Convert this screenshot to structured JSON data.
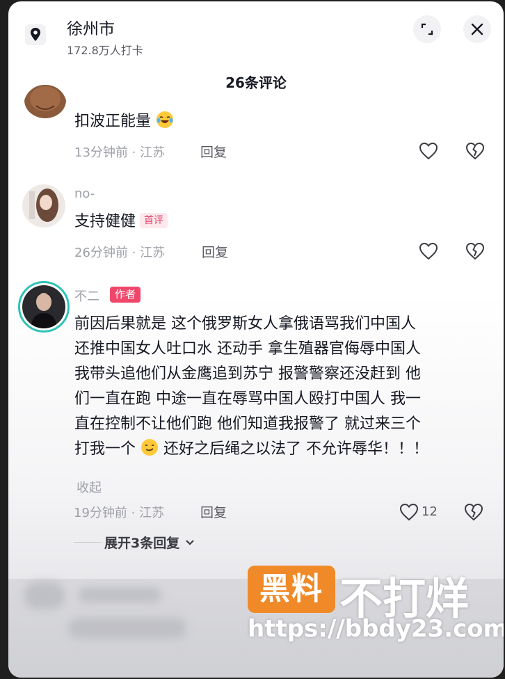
{
  "header": {
    "location_icon": "map-pin-icon",
    "title": "徐州市",
    "subtitle": "172.8万人打卡",
    "expand_icon": "collapse-corner-icon",
    "close_icon": "close-icon"
  },
  "comments_count": "26条评论",
  "comments": [
    {
      "text": "扣波正能量",
      "emoji": "laughing-tears-emoji",
      "time_location": "13分钟前 · 江苏",
      "reply_label": "回复"
    },
    {
      "username": "no-",
      "text": "支持健健",
      "tag": "首评",
      "time_location": "26分钟前 · 江苏",
      "reply_label": "回复"
    },
    {
      "username": "不二",
      "tag": "作者",
      "lines": [
        "前因后果就是 这个俄罗斯女人拿俄语骂我们中国人",
        "还推中国女人吐口水 还动手 拿生殖器官侮辱中国人",
        "我带头追他们从金鹰追到苏宁 报警警察还没赶到 他",
        "们一直在跑 中途一直在辱骂中国人殴打中国人 我一",
        "直在控制不让他们跑 他们知道我报警了 就过来三个",
        "打我一个",
        "还好之后绳之以法了 不允许辱华！！！"
      ],
      "collapse_label": "收起",
      "time_location": "19分钟前 · 江苏",
      "reply_label": "回复",
      "likes": "12",
      "expand_replies": "展开3条回复"
    }
  ],
  "watermark": {
    "logo": "黑料",
    "text": "不打烊",
    "url": "https://bbdy23.com"
  },
  "colors": {
    "author_tag": "#f0466a",
    "first_tag": "#e34a6f",
    "watermark_orange": "#f08a29",
    "avatar_ring": "#2fc3b8"
  }
}
